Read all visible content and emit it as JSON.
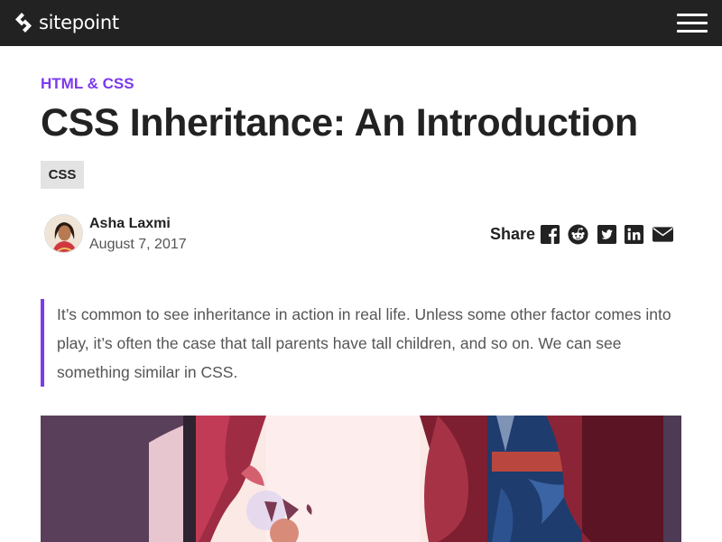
{
  "header": {
    "brand": "sitepoint",
    "logo_icon": "sitepoint-logo-icon",
    "menu_icon": "hamburger-menu-icon",
    "background": "#222222"
  },
  "article": {
    "category": "HTML & CSS",
    "title": "CSS Inheritance: An Introduction",
    "tags": [
      "CSS"
    ],
    "author": {
      "name": "Asha Laxmi",
      "date": "August 7, 2017"
    },
    "share": {
      "label": "Share",
      "icons": [
        "facebook-icon",
        "reddit-icon",
        "twitter-icon",
        "linkedin-icon",
        "email-icon"
      ]
    },
    "intro": "It’s common to see inheritance in action in real life. Unless some other factor comes into play, it’s often the case that tall parents have tall children, and so on. We can see something similar in CSS."
  },
  "colors": {
    "accent": "#7c3aed",
    "text": "#222222",
    "muted": "#555555",
    "tag_bg": "#e3e3e3"
  }
}
